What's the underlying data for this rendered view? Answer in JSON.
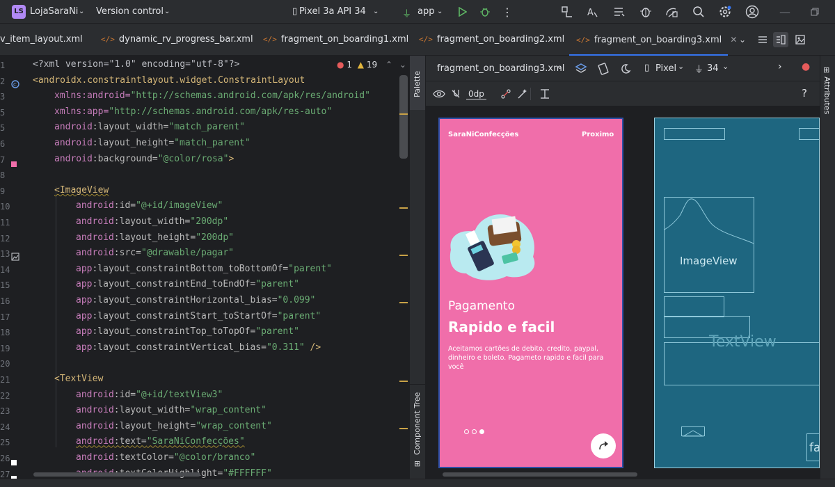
{
  "app": {
    "project_badge": "LS",
    "project_name": "LojaSaraNi",
    "vcs_label": "Version control",
    "device_label": "Pixel 3a API 34",
    "run_config": "app"
  },
  "tabs": [
    {
      "label": "v_item_layout.xml"
    },
    {
      "label": "dynamic_rv_progress_bar.xml"
    },
    {
      "label": "fragment_on_boarding1.xml"
    },
    {
      "label": "fragment_on_boarding2.xml"
    },
    {
      "label": "fragment_on_boarding3.xml",
      "active": true
    }
  ],
  "editor": {
    "errors": "1",
    "warnings": "19",
    "line_numbers": [
      "1",
      "2",
      "3",
      "5",
      "5",
      "6",
      "7",
      "8",
      "9",
      "10",
      "11",
      "12",
      "13",
      "14",
      "15",
      "16",
      "17",
      "18",
      "19",
      "20",
      "21",
      "22",
      "23",
      "24",
      "25",
      "26",
      "27"
    ],
    "lines": [
      [
        "<?xml version=\"1.0\" encoding=\"utf-8\"?>"
      ],
      [
        "<androidx.constraintlayout.widget.ConstraintLayout"
      ],
      [
        "xmlns:android=",
        "\"http://schemas.android.com/apk/res/android\""
      ],
      [
        "xmlns:app=",
        "\"http://schemas.android.com/apk/res-auto\""
      ],
      [
        "android",
        ":layout_width=",
        "\"match_parent\""
      ],
      [
        "android",
        ":layout_height=",
        "\"match_parent\""
      ],
      [
        "android",
        ":background=",
        "\"@color/rosa\"",
        ">"
      ],
      [
        ""
      ],
      [
        "<ImageView"
      ],
      [
        "android",
        ":id=",
        "\"@+id/imageView\""
      ],
      [
        "android",
        ":layout_width=",
        "\"200dp\""
      ],
      [
        "android",
        ":layout_height=",
        "\"200dp\""
      ],
      [
        "android",
        ":src=",
        "\"@drawable/pagar\""
      ],
      [
        "app",
        ":layout_constraintBottom_toBottomOf=",
        "\"parent\""
      ],
      [
        "app",
        ":layout_constraintEnd_toEndOf=",
        "\"parent\""
      ],
      [
        "app",
        ":layout_constraintHorizontal_bias=",
        "\"0.099\""
      ],
      [
        "app",
        ":layout_constraintStart_toStartOf=",
        "\"parent\""
      ],
      [
        "app",
        ":layout_constraintTop_toTopOf=",
        "\"parent\""
      ],
      [
        "app",
        ":layout_constraintVertical_bias=",
        "\"0.311\"",
        " />"
      ],
      [
        ""
      ],
      [
        "<TextView"
      ],
      [
        "android",
        ":id=",
        "\"@+id/textView3\""
      ],
      [
        "android",
        ":layout_width=",
        "\"wrap_content\""
      ],
      [
        "android",
        ":layout_height=",
        "\"wrap_content\""
      ],
      [
        "android",
        ":text=",
        "\"SaraNiConfecções\""
      ],
      [
        "android",
        ":textColor=",
        "\"@color/branco\""
      ],
      [
        "android",
        ":textColorHighlight=",
        "\"#FFFFFF\""
      ]
    ]
  },
  "side_panels": {
    "palette": "Palette",
    "component_tree": "Component Tree",
    "attributes": "Attributes"
  },
  "design": {
    "file_label": "fragment_on_boarding3.xml",
    "device": "Pixel",
    "api": "34",
    "margin": "0dp",
    "help": "?"
  },
  "preview": {
    "brand": "SaraNiConfecções",
    "next": "Proximo",
    "subtitle": "Pagamento",
    "title": "Rapido e facil",
    "body": "Aceitamos cartões de debito, credito, paypal, dinheiro e boleto. Pagameto rapido e facil para você",
    "page_dots": 3,
    "active_dot": 3,
    "fab_icon": "share-arrow-icon"
  },
  "blueprint": {
    "image_label": "ImageView",
    "text_label": "TextView",
    "partial_label": "fa"
  },
  "colors": {
    "screen_pink": "#f06eaa",
    "blueprint": "#1e6680",
    "accent": "#3574f0"
  }
}
